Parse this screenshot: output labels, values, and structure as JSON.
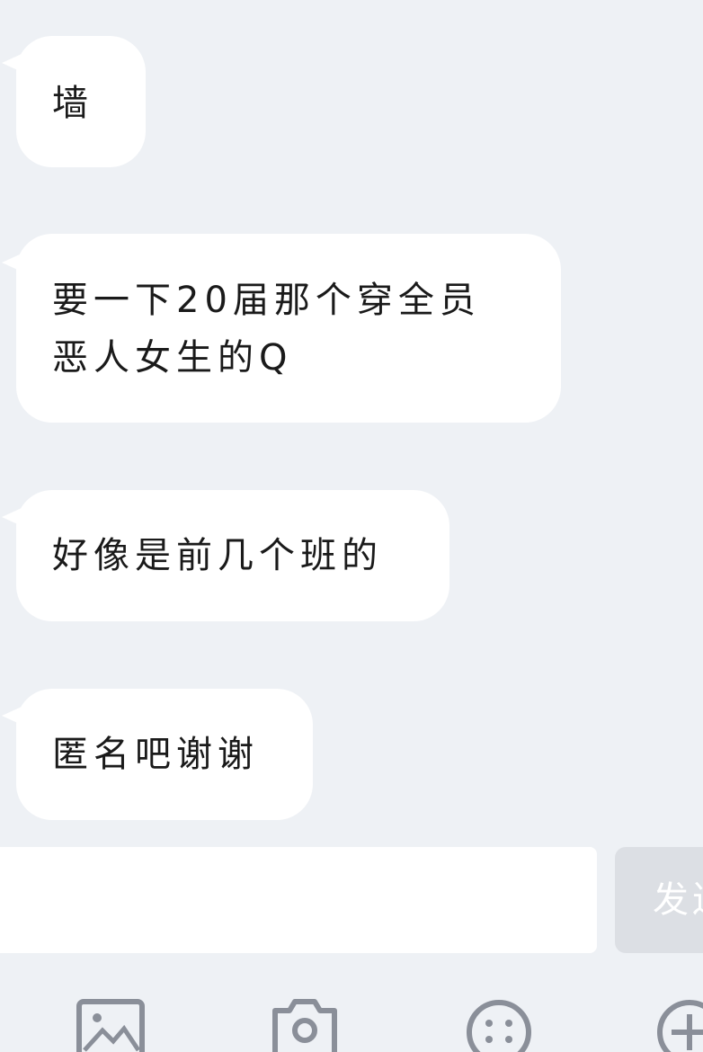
{
  "messages": [
    {
      "text": "墙"
    },
    {
      "text": "要一下20届那个穿全员\n恶人女生的Q"
    },
    {
      "text": "好像是前几个班的"
    },
    {
      "text": "匿名吧谢谢"
    }
  ],
  "composer": {
    "input_value": "",
    "send_label": "发送"
  },
  "toolbar": {
    "icons": [
      "image-icon",
      "camera-icon",
      "emoji-icon",
      "plus-icon"
    ]
  },
  "colors": {
    "background": "#eef1f5",
    "bubble": "#ffffff",
    "send_button_disabled": "#dcdfe4",
    "icon": "#8a8f99"
  }
}
